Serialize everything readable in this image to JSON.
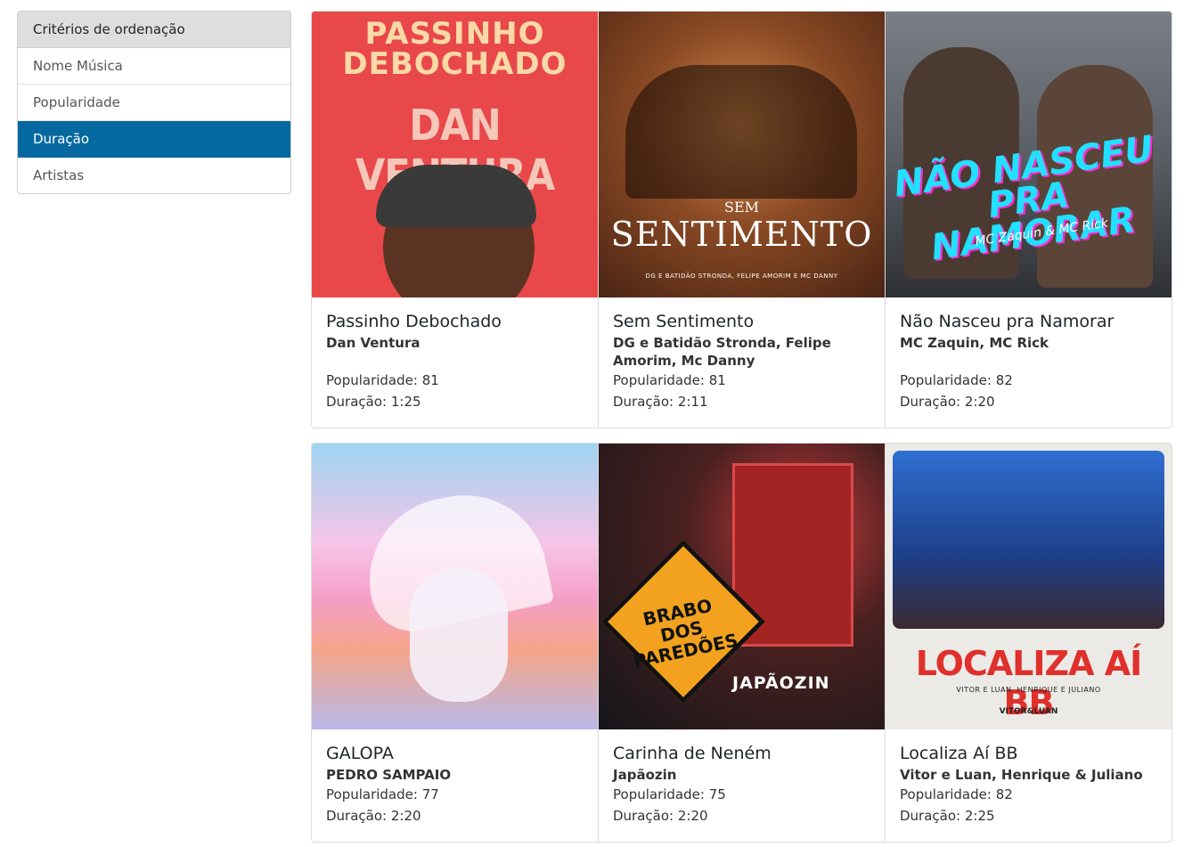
{
  "sidebar": {
    "header": "Critérios de ordenação",
    "items": [
      {
        "label": "Nome Música",
        "active": false
      },
      {
        "label": "Popularidade",
        "active": false
      },
      {
        "label": "Duração",
        "active": true
      },
      {
        "label": "Artistas",
        "active": false
      }
    ]
  },
  "cards": [
    {
      "title": "Passinho Debochado",
      "artist": "Dan Ventura",
      "popularity": "Popularidade: 81",
      "duration": "Duração: 1:25",
      "cover_text": [
        "PASSINHO",
        "DEBOCHADO",
        "DAN VENTURA"
      ]
    },
    {
      "title": "Sem Sentimento",
      "artist": "DG e Batidão Stronda, Felipe Amorim, Mc Danny",
      "popularity": "Popularidade: 81",
      "duration": "Duração: 2:11",
      "cover_text": [
        "SEM",
        "SENTIMENTO",
        "DG E BATIDÃO STRONDA, FELIPE AMORIM E MC DANNY"
      ]
    },
    {
      "title": "Não Nasceu pra Namorar",
      "artist": "MC Zaquin, MC Rick",
      "popularity": "Popularidade: 82",
      "duration": "Duração: 2:20",
      "cover_text": [
        "NÃO NASCEU PRA NAMORAR",
        "MC Zaquin & MC Rick"
      ]
    },
    {
      "title": "GALOPA",
      "artist": "PEDRO SAMPAIO",
      "popularity": "Popularidade: 77",
      "duration": "Duração: 2:20"
    },
    {
      "title": "Carinha de Neném",
      "artist": "Japãozin",
      "popularity": "Popularidade: 75",
      "duration": "Duração: 2:20",
      "cover_text": [
        "BRABO DOS PAREDÕES",
        "JAPÃOZIN"
      ]
    },
    {
      "title": "Localiza Aí BB",
      "artist": "Vitor e Luan, Henrique & Juliano",
      "popularity": "Popularidade: 82",
      "duration": "Duração: 2:25",
      "cover_text": [
        "LOCALIZA AÍ BB",
        "VITOR E LUAN, HENRIQUE E JULIANO",
        "VITOR&LUAN"
      ]
    }
  ],
  "colors": {
    "active_item": "#0569a0",
    "header_bg": "#dedede"
  }
}
